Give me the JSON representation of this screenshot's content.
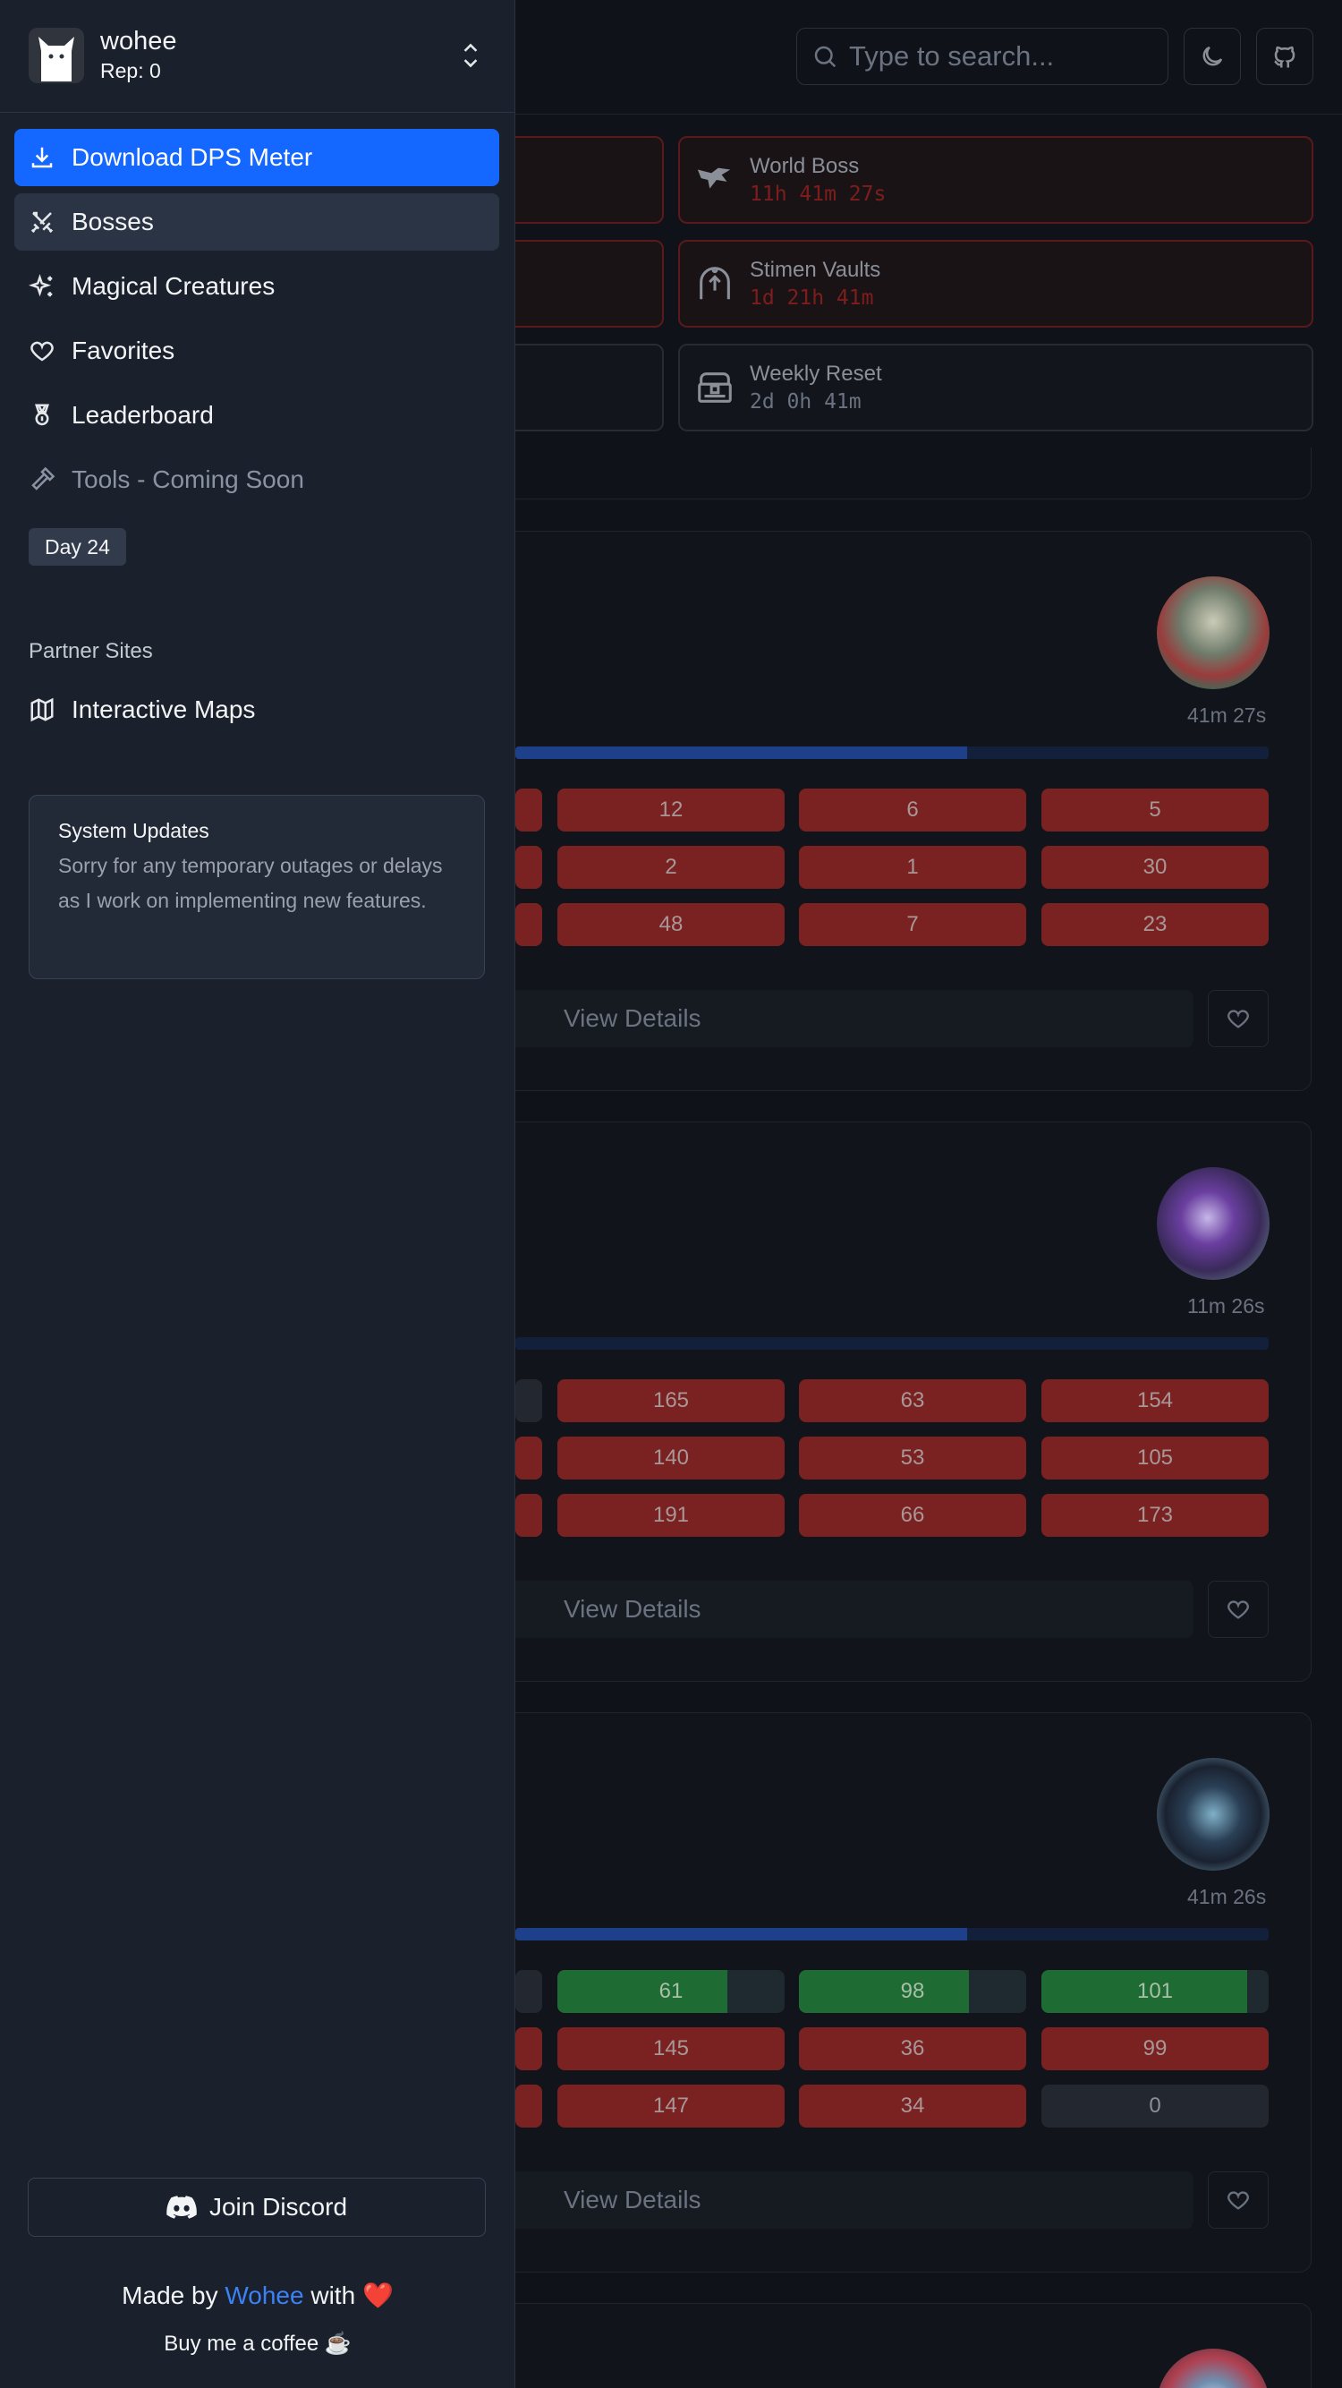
{
  "header": {
    "search_placeholder": "Type to search...",
    "theme_icon": "moon-icon",
    "github_icon": "github-icon"
  },
  "timers": [
    {
      "name": "World Boss",
      "time": "11h 41m 27s",
      "alert": true
    },
    {
      "name": "Stimen Vaults",
      "time": "1d 21h 41m",
      "alert": true
    },
    {
      "name": "Weekly Reset",
      "time": "2d 0h 41m",
      "alert": false
    }
  ],
  "cards": [
    {
      "time": "41m 27s",
      "progress": 0.6,
      "rows": [
        [
          "12",
          "6",
          "5"
        ],
        [
          "2",
          "1",
          "30"
        ],
        [
          "48",
          "7",
          "23"
        ]
      ],
      "view_label": "View Details"
    },
    {
      "time": "11m 26s",
      "progress": 0,
      "rows": [
        [
          "165",
          "63",
          "154"
        ],
        [
          "140",
          "53",
          "105"
        ],
        [
          "191",
          "66",
          "173"
        ]
      ],
      "view_label": "View Details"
    },
    {
      "time": "41m 26s",
      "progress": 0.6,
      "rows": [
        [
          "61",
          "98",
          "101"
        ],
        [
          "145",
          "36",
          "99"
        ],
        [
          "147",
          "34",
          "0"
        ]
      ],
      "view_label": "View Details"
    }
  ],
  "sidebar": {
    "user": {
      "name": "wohee",
      "rep": "Rep: 0"
    },
    "nav": [
      {
        "label": "Download DPS Meter",
        "icon": "download-icon",
        "state": "primary"
      },
      {
        "label": "Bosses",
        "icon": "swords-icon",
        "state": "active"
      },
      {
        "label": "Magical Creatures",
        "icon": "sparkles-icon",
        "state": "normal"
      },
      {
        "label": "Favorites",
        "icon": "heart-icon",
        "state": "normal"
      },
      {
        "label": "Leaderboard",
        "icon": "medal-icon",
        "state": "normal"
      },
      {
        "label": "Tools - Coming Soon",
        "icon": "hammer-icon",
        "state": "disabled"
      }
    ],
    "day_badge": "Day 24",
    "partner_label": "Partner Sites",
    "partner_link": "Interactive Maps",
    "notice": {
      "title": "System Updates",
      "body": "Sorry for any temporary outages or delays as I work on implementing new features."
    },
    "discord_label": "Join Discord",
    "footer": {
      "made_by": "Made by",
      "author": "Wohee",
      "with": "with",
      "heart": "❤️",
      "coffee": "Buy me a coffee ☕"
    }
  },
  "colors": {
    "accent": "#1467ff",
    "sidebar_bg": "#1a202c",
    "danger": "#7a2222",
    "success": "#1f6b34"
  }
}
